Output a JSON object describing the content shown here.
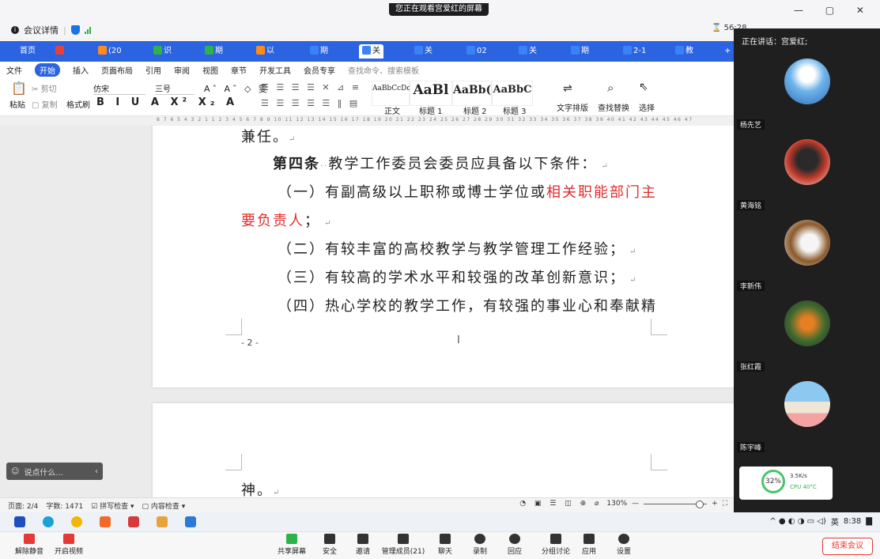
{
  "meeting": {
    "share_banner": "您正在观看宫爱红的屏幕",
    "info_label": "会议详情",
    "timer": "56:28",
    "window_controls": "— ▢ ✕",
    "speaking": "正在讲话：宫爱红;"
  },
  "wps": {
    "tabs": [
      {
        "label": "首页",
        "color": "#2b63e0"
      },
      {
        "label": "",
        "color": "#e8413c"
      },
      {
        "label": "(20",
        "color": "#ff8c1a"
      },
      {
        "label": "识",
        "color": "#2db34a"
      },
      {
        "label": "期",
        "color": "#2db34a"
      },
      {
        "label": "以",
        "color": "#ff8c1a"
      },
      {
        "label": "期",
        "color": "#3b82f6"
      },
      {
        "label": "关",
        "color": "#3b82f6",
        "active": true
      },
      {
        "label": "关",
        "color": "#3b82f6"
      },
      {
        "label": "02",
        "color": "#3b82f6"
      },
      {
        "label": "关",
        "color": "#3b82f6"
      },
      {
        "label": "期",
        "color": "#3b82f6"
      },
      {
        "label": "2-1",
        "color": "#3b82f6"
      },
      {
        "label": "教",
        "color": "#3b82f6"
      }
    ],
    "menu": [
      "文件",
      "开始",
      "插入",
      "页面布局",
      "引用",
      "审阅",
      "视图",
      "章节",
      "开发工具",
      "会员专享"
    ],
    "search_placeholder": "查找命令、搜索模板",
    "ribbon": {
      "paste": "粘贴",
      "cut": "剪切",
      "copy": "复制",
      "format_painter": "格式刷",
      "font": "仿宋",
      "size": "三号",
      "styles": [
        "正文",
        "标题 1",
        "标题 2",
        "标题 3"
      ],
      "style_samples": [
        "AaBbCcDd",
        "AaBl",
        "AaBb(",
        "AaBbC"
      ],
      "text_layout": "文字排版",
      "find_replace": "查找替换",
      "select": "选择"
    },
    "ruler": "8 7 6 5 4 3 2 1 1 2 3 4 5 6 7 8 9 10 11 12 13 14 15 16 17 18 19 20 21 22 23 24 25 26 27 28 29 30 31 32 33 34 35 36 37 38 39 40 41 42 43 44 45 46 47",
    "document": {
      "line0": "兼任。",
      "article_title": "第四条",
      "article_text": "教学工作委员会委员应具备以下条件：",
      "item1a": "（一）有副高级以上职称或博士学位或",
      "item1_red_a": "相关职能部门主",
      "item1_red_b": "要负责人",
      "item1_end": "；",
      "item2": "（二）有较丰富的高校教学与教学管理工作经验；",
      "item3": "（三）有较高的学术水平和较强的改革创新意识；",
      "item4": "（四）热心学校的教学工作，有较强的事业心和奉献精",
      "page_number": "- 2 -",
      "page2_line": "神。"
    },
    "status": {
      "page": "页面: 2/4",
      "words": "字数: 1471",
      "spell": "拼写检查",
      "content": "内容检查",
      "zoom": "130%"
    },
    "comment_placeholder": "说点什么..."
  },
  "participants": [
    {
      "name": "杨先艺"
    },
    {
      "name": "黄海铭"
    },
    {
      "name": "李新伟"
    },
    {
      "name": "张红霞"
    },
    {
      "name": "陈宇峰"
    }
  ],
  "cpu": {
    "percent": "32%",
    "net": "3.5K/s",
    "temp": "CPU 40°C"
  },
  "taskbar": {
    "time": "8:38",
    "ime": "英"
  },
  "toolbar": {
    "unmute": "解除静音",
    "video": "开启视频",
    "share": "共享屏幕",
    "security": "安全",
    "invite": "邀请",
    "members": "管理成员(21)",
    "chat": "聊天",
    "record": "录制",
    "reaction": "回应",
    "breakout": "分组讨论",
    "apps": "应用",
    "settings": "设置",
    "end": "结束会议"
  }
}
